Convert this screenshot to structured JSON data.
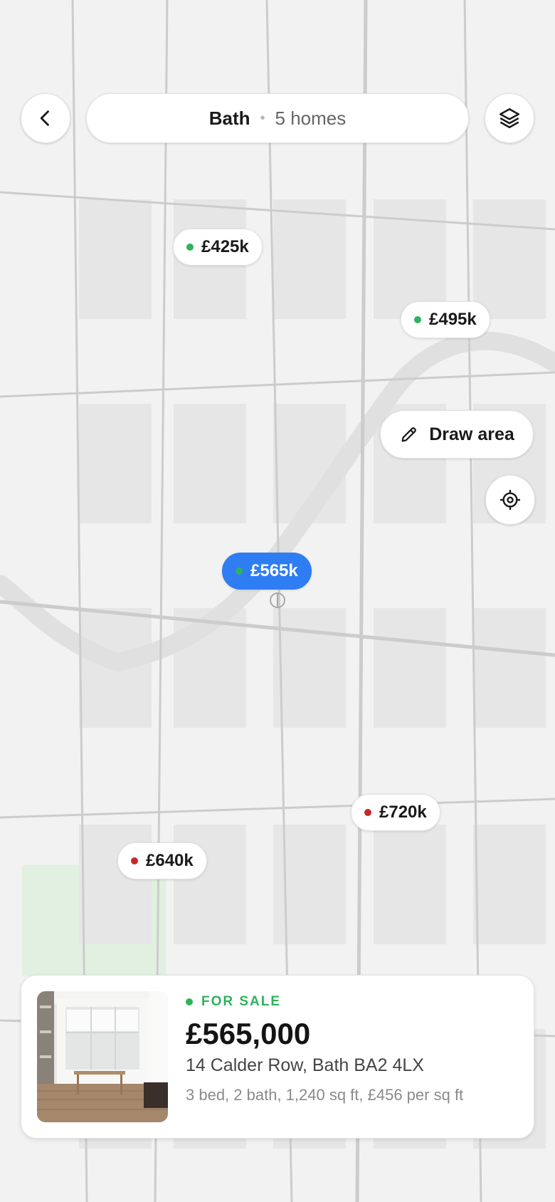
{
  "header": {
    "location": "Bath",
    "separator": "•",
    "home_count": "5 homes"
  },
  "pins": [
    {
      "label": "£425k",
      "status": "available"
    },
    {
      "label": "£495k",
      "status": "available"
    },
    {
      "label": "£565k",
      "status": "selected"
    },
    {
      "label": "£720k",
      "status": "sold"
    },
    {
      "label": "£640k",
      "status": "sold"
    }
  ],
  "actions": {
    "draw_area_label": "Draw area"
  },
  "listing": {
    "status": "FOR SALE",
    "price": "£565,000",
    "address": "14 Calder Row, Bath BA2 4LX",
    "details": "3 bed, 2 bath, 1,240 sq ft, £456 per sq ft"
  },
  "colors": {
    "accent": "#2f7df3",
    "available_dot": "#2fb25a",
    "sold_dot": "#c62828",
    "map_bg": "#f2f2f2",
    "park": "#dcefdc"
  },
  "icons": {
    "back": "chevron-left-icon",
    "layers": "layers-icon",
    "draw": "pencil-icon",
    "locate": "crosshair-icon"
  }
}
